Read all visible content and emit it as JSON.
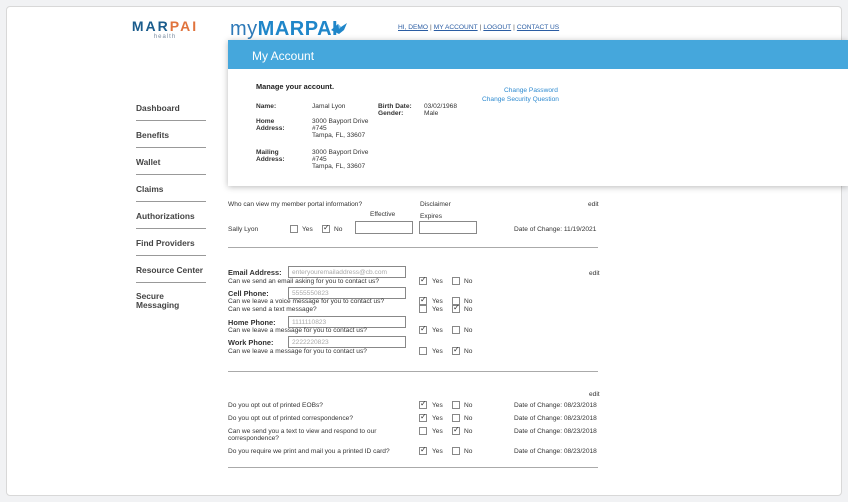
{
  "brand": {
    "name_a": "MAR",
    "name_b": "PAI",
    "sub": "health"
  },
  "logo": {
    "my": "my",
    "name": "MARPAI"
  },
  "toplinks": [
    "HI, DEMO",
    "MY ACCOUNT",
    "LOGOUT",
    "CONTACT US"
  ],
  "nav": [
    "Dashboard",
    "Benefits",
    "Wallet",
    "Claims",
    "Authorizations",
    "Find Providers",
    "Resource Center",
    "Secure Messaging"
  ],
  "account": {
    "title": "My Account",
    "manage": "Manage your account.",
    "change_password": "Change Password",
    "change_security": "Change Security Question",
    "name_label": "Name:",
    "name": "Jamal Lyon",
    "birth_label": "Birth Date:",
    "birth": "03/02/1968",
    "gender_label": "Gender:",
    "gender": "Male",
    "home_label": "Home Address:",
    "home": [
      "3000 Bayport Drive",
      "#745",
      "Tampa, FL, 33607"
    ],
    "mail_label": "Mailing Address:",
    "mail": [
      "3000 Bayport Drive",
      "#745",
      "Tampa, FL, 33607"
    ]
  },
  "portal": {
    "question": "Who can view my member portal information?",
    "disclaimer": "Disclaimer",
    "edit": "edit",
    "effective": "Effective",
    "expires": "Expires",
    "person": "Sally Lyon",
    "yes": "Yes",
    "no": "No",
    "date_change": "Date of Change: 11/19/2021"
  },
  "contact": {
    "edit": "edit",
    "email_label": "Email Address:",
    "email_placeholder": "enteryouremailaddress@cb.com",
    "email_q": "Can we send an email asking for you to contact us?",
    "cell_label": "Cell Phone:",
    "cell_value": "5555550823",
    "cell_q1": "Can we leave a voice message for you to contact us?",
    "cell_q2": "Can we send a text message?",
    "home_label": "Home Phone:",
    "home_value": "1111110823",
    "home_q": "Can we leave a message for you to contact us?",
    "work_label": "Work Phone:",
    "work_value": "2222220823",
    "work_q": "Can we leave a message for you to contact us?",
    "yes": "Yes",
    "no": "No"
  },
  "prefs": {
    "edit": "edit",
    "yes": "Yes",
    "no": "No",
    "rows": [
      {
        "q": "Do you opt out of printed EOBs?",
        "date": "Date of Change: 08/23/2018"
      },
      {
        "q": "Do you opt out of printed correspondence?",
        "date": "Date of Change: 08/23/2018"
      },
      {
        "q1": "Can we send you a text to view and respond to our",
        "q2": "correspondence?",
        "date": "Date of Change: 08/23/2018"
      },
      {
        "q": "Do you require we print and mail you a printed ID card?",
        "date": "Date of Change: 08/23/2018"
      }
    ]
  }
}
